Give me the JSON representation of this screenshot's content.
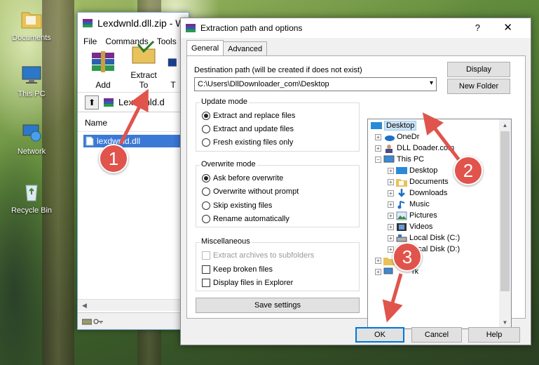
{
  "desktop": {
    "icons": [
      {
        "label": "Documents"
      },
      {
        "label": "This PC"
      },
      {
        "label": "Network"
      },
      {
        "label": "Recycle Bin"
      }
    ]
  },
  "winrar": {
    "title": "Lexdwnld.dll.zip - W",
    "menu": [
      "File",
      "Commands",
      "Tools"
    ],
    "toolbar": {
      "add": "Add",
      "extract_to": "Extract To",
      "third": "T"
    },
    "address": "Lexdwnld.d",
    "column_name": "Name",
    "file": "lexdwnld.dll"
  },
  "dialog": {
    "title": "Extraction path and options",
    "help": "?",
    "close": "✕",
    "tabs": [
      "General",
      "Advanced"
    ],
    "dest_label": "Destination path (will be created if does not exist)",
    "dest_value": "C:\\Users\\DllDownloader_com\\Desktop",
    "display_button": "Display",
    "new_folder_button": "New Folder",
    "update_mode": {
      "title": "Update mode",
      "options": [
        "Extract and replace files",
        "Extract and update files",
        "Fresh existing files only"
      ],
      "selected": 0
    },
    "overwrite_mode": {
      "title": "Overwrite mode",
      "options": [
        "Ask before overwrite",
        "Overwrite without prompt",
        "Skip existing files",
        "Rename automatically"
      ],
      "selected": 0
    },
    "misc": {
      "title": "Miscellaneous",
      "options": [
        "Extract archives to subfolders",
        "Keep broken files",
        "Display files in Explorer"
      ]
    },
    "save_settings": "Save settings",
    "tree": [
      "Desktop",
      "OneDr",
      "DLL Do",
      "ader.com",
      "This PC",
      "Desktop",
      "Documents",
      "Downloads",
      "Music",
      "Pictures",
      "Videos",
      "Local Disk (C:)",
      "Local Disk (D:)",
      "L",
      "ies",
      "rk"
    ],
    "ok": "OK",
    "cancel": "Cancel",
    "help_button": "Help"
  },
  "annotations": {
    "steps": [
      "1",
      "2",
      "3"
    ],
    "color": "#e0544c"
  }
}
